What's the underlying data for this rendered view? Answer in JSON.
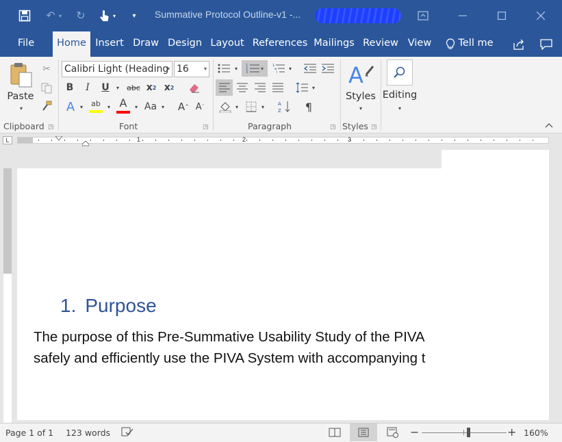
{
  "titlebar": {
    "title": "Summative Protocol Outline-v1  -...",
    "icons": [
      "save-icon",
      "undo-icon",
      "redo-icon",
      "touch-mode-icon",
      "customize-qat-icon",
      "ribbon-display-icon",
      "minimize-icon",
      "maximize-icon",
      "close-icon"
    ]
  },
  "tabs": [
    {
      "label": "File"
    },
    {
      "label": "Home"
    },
    {
      "label": "Insert"
    },
    {
      "label": "Draw"
    },
    {
      "label": "Design"
    },
    {
      "label": "Layout"
    },
    {
      "label": "References"
    },
    {
      "label": "Mailings"
    },
    {
      "label": "Review"
    },
    {
      "label": "View"
    }
  ],
  "tell_me": "Tell me",
  "ribbon": {
    "clipboard": {
      "label": "Clipboard",
      "paste": "Paste"
    },
    "font": {
      "label": "Font",
      "font_name": "Calibri Light (Heading",
      "font_size": "16",
      "bold": "B",
      "italic": "I",
      "underline": "U",
      "strikethrough": "abc",
      "subscript": "x",
      "subscript_mark": "2",
      "superscript": "x",
      "superscript_mark": "2",
      "text_effects": "A",
      "highlight": "ab",
      "font_color": "A",
      "change_case": "Aa",
      "grow": "A",
      "shrink": "A"
    },
    "paragraph": {
      "label": "Paragraph",
      "pilcrow": "¶"
    },
    "styles": {
      "label": "Styles",
      "button": "Styles"
    },
    "editing": {
      "button": "Editing"
    }
  },
  "ruler": {
    "numbers": [
      "1",
      "2",
      "3"
    ]
  },
  "document": {
    "heading_number": "1.",
    "heading": "Purpose",
    "body_lines": [
      "The purpose of this Pre-Summative Usability Study of the PIVA",
      "safely and efficiently use the PIVA System with accompanying t"
    ]
  },
  "statusbar": {
    "page": "Page 1 of 1",
    "words": "123 words",
    "zoom_out": "−",
    "zoom_in": "+",
    "zoom": "160%",
    "zoom_level_percent": 160
  },
  "colors": {
    "accent": "#2b579a",
    "heading": "#2f5496",
    "highlight": "#ffff00",
    "font_color": "#ff0000"
  }
}
